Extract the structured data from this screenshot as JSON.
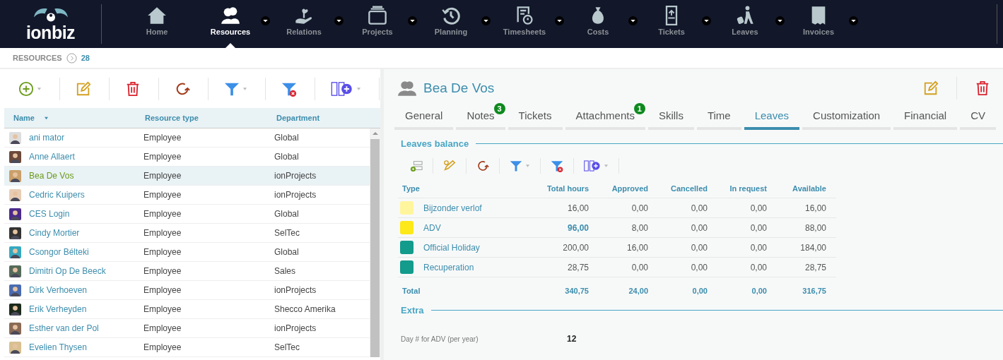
{
  "nav": {
    "logo": "ionbiz",
    "items": [
      {
        "label": "Home",
        "selected": false,
        "dropdown": false
      },
      {
        "label": "Resources",
        "selected": true,
        "dropdown": true
      },
      {
        "label": "Relations",
        "selected": false,
        "dropdown": true
      },
      {
        "label": "Projects",
        "selected": false,
        "dropdown": true
      },
      {
        "label": "Planning",
        "selected": false,
        "dropdown": true
      },
      {
        "label": "Timesheets",
        "selected": false,
        "dropdown": true
      },
      {
        "label": "Costs",
        "selected": false,
        "dropdown": true
      },
      {
        "label": "Tickets",
        "selected": false,
        "dropdown": true
      },
      {
        "label": "Leaves",
        "selected": false,
        "dropdown": true
      },
      {
        "label": "Invoices",
        "selected": false,
        "dropdown": true
      }
    ]
  },
  "breadcrumb": {
    "label": "RESOURCES",
    "count": "28"
  },
  "resources": {
    "columns": [
      "Name",
      "Resource type",
      "Department"
    ],
    "rows": [
      {
        "name": "ani mator",
        "type": "Employee",
        "department": "Global",
        "selected": false
      },
      {
        "name": "Anne Allaert",
        "type": "Employee",
        "department": "Global",
        "selected": false
      },
      {
        "name": "Bea De Vos",
        "type": "Employee",
        "department": "ionProjects",
        "selected": true
      },
      {
        "name": "Cedric Kuipers",
        "type": "Employee",
        "department": "ionProjects",
        "selected": false
      },
      {
        "name": "CES Login",
        "type": "Employee",
        "department": "Global",
        "selected": false
      },
      {
        "name": "Cindy Mortier",
        "type": "Employee",
        "department": "SelTec",
        "selected": false
      },
      {
        "name": "Csongor Bélteki",
        "type": "Employee",
        "department": "Global",
        "selected": false
      },
      {
        "name": "Dimitri Op De Beeck",
        "type": "Employee",
        "department": "Sales",
        "selected": false
      },
      {
        "name": "Dirk Verhoeven",
        "type": "Employee",
        "department": "ionProjects",
        "selected": false
      },
      {
        "name": "Erik Verheyden",
        "type": "Employee",
        "department": "Shecco Amerika",
        "selected": false
      },
      {
        "name": "Esther van der Pol",
        "type": "Employee",
        "department": "ionProjects",
        "selected": false
      },
      {
        "name": "Evelien Thysen",
        "type": "Employee",
        "department": "SelTec",
        "selected": false
      }
    ]
  },
  "detail": {
    "title": "Bea De Vos",
    "tabs": [
      {
        "label": "General",
        "selected": false
      },
      {
        "label": "Notes",
        "selected": false,
        "badge": "3"
      },
      {
        "label": "Tickets",
        "selected": false
      },
      {
        "label": "Attachments",
        "selected": false,
        "badge": "1"
      },
      {
        "label": "Skills",
        "selected": false
      },
      {
        "label": "Time",
        "selected": false
      },
      {
        "label": "Leaves",
        "selected": true
      },
      {
        "label": "Customization",
        "selected": false
      },
      {
        "label": "Financial",
        "selected": false
      },
      {
        "label": "CV",
        "selected": false
      }
    ],
    "balance": {
      "title": "Leaves balance",
      "columns": [
        "Type",
        "Total hours",
        "Approved",
        "Cancelled",
        "In request",
        "Available"
      ],
      "rows": [
        {
          "type": "Bijzonder verlof",
          "color": "#fff59d",
          "total_hours": "16,00",
          "emphasized": false,
          "approved": "0,00",
          "cancelled": "0,00",
          "in_request": "0,00",
          "available": "16,00"
        },
        {
          "type": "ADV",
          "color": "#fde81a",
          "total_hours": "96,00",
          "emphasized": true,
          "approved": "8,00",
          "cancelled": "0,00",
          "in_request": "0,00",
          "available": "88,00"
        },
        {
          "type": "Official Holiday",
          "color": "#139b8c",
          "total_hours": "200,00",
          "emphasized": false,
          "approved": "16,00",
          "cancelled": "0,00",
          "in_request": "0,00",
          "available": "184,00"
        },
        {
          "type": "Recuperation",
          "color": "#139b8c",
          "total_hours": "28,75",
          "emphasized": false,
          "approved": "0,00",
          "cancelled": "0,00",
          "in_request": "0,00",
          "available": "28,75"
        }
      ],
      "total": {
        "label": "Total",
        "total_hours": "340,75",
        "approved": "24,00",
        "cancelled": "0,00",
        "in_request": "0,00",
        "available": "316,75"
      }
    },
    "extra": {
      "title": "Extra",
      "field_label": "Day # for ADV (per year)",
      "field_value": "12"
    }
  }
}
